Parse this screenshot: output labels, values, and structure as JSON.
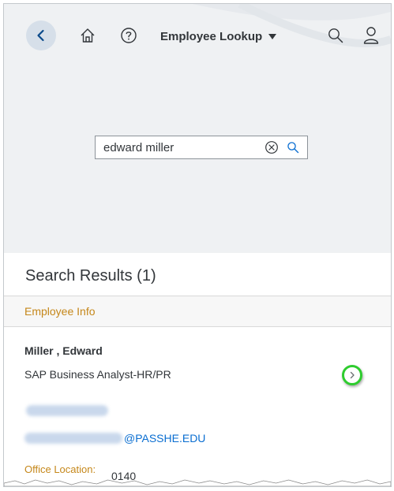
{
  "header": {
    "app_title": "Employee Lookup"
  },
  "search": {
    "value": "edward miller"
  },
  "results": {
    "title": "Search Results (1)",
    "group_label": "Employee Info",
    "items": [
      {
        "name": "Miller , Edward",
        "job_title": "SAP Business Analyst-HR/PR",
        "email_domain": "@PASSHE.EDU",
        "office_label": "Office Location:",
        "office_value": "0140"
      }
    ]
  },
  "icons": {
    "back": "chevron-left-icon",
    "home": "home-icon",
    "help": "help-icon",
    "title_menu": "caret-down-icon",
    "search": "search-icon",
    "user": "user-icon",
    "clear": "clear-icon",
    "navigate": "chevron-right-icon"
  },
  "colors": {
    "accent": "#0a6ed1",
    "group_label": "#c5871a",
    "highlight_ring": "#2ecc2e",
    "shell_background": "#eff1f3"
  }
}
